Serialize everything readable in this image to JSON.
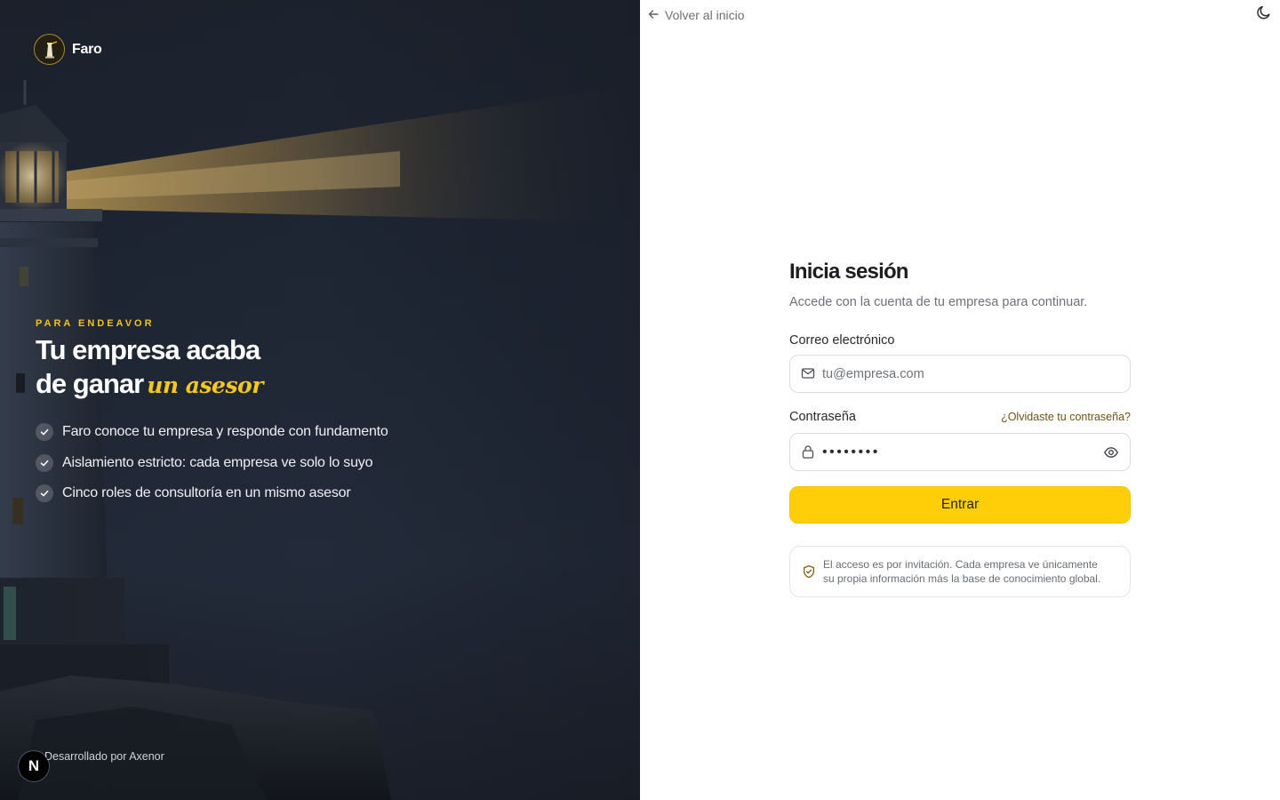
{
  "brand": {
    "name": "Faro"
  },
  "hero": {
    "eyebrow": "PARA ENDEAVOR",
    "headline_line1": "Tu empresa acaba",
    "headline_line2": "de ganar",
    "headline_accent": "un asesor",
    "features": [
      "Faro conoce tu empresa y responde con fundamento",
      "Aislamiento estricto: cada empresa ve solo lo suyo",
      "Cinco roles de consultoría en un mismo asesor"
    ],
    "credit": "Desarrollado por Axenor",
    "framework_badge": "N"
  },
  "nav": {
    "back_label": "Volver al inicio",
    "back_icon": "arrow-left-icon",
    "theme_icon": "moon-icon"
  },
  "login": {
    "title": "Inicia sesión",
    "subtitle": "Accede con la cuenta de tu empresa para continuar.",
    "email_label": "Correo electrónico",
    "email_placeholder": "tu@empresa.com",
    "email_value": "",
    "password_label": "Contraseña",
    "forgot_label": "¿Olvidaste tu contraseña?",
    "password_value": "••••••••",
    "submit_label": "Entrar",
    "notice_line1": "El acceso es por invitación. Cada empresa ve únicamente",
    "notice_line2": "su propia información más la base de conocimiento global."
  },
  "colors": {
    "accent": "#fecf08",
    "hero_background": "#1f2735",
    "eyebrow": "#f3c21a",
    "forgot_link": "#6b5412"
  }
}
